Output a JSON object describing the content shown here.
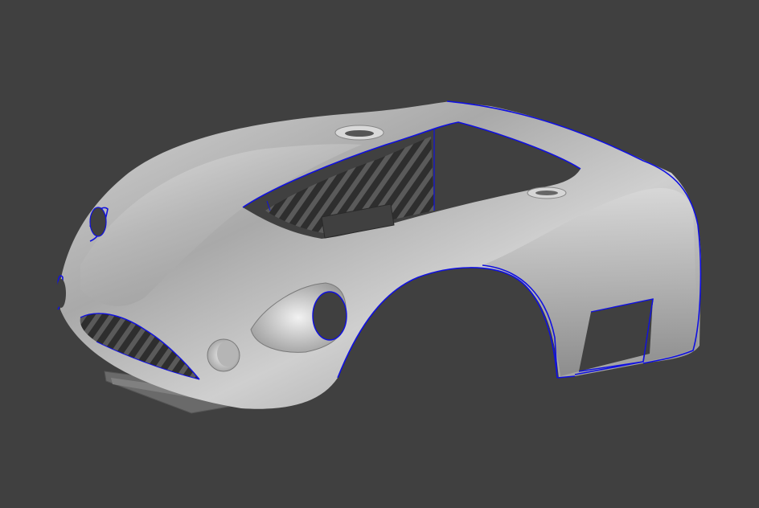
{
  "viewport": {
    "background_color": "#404040"
  },
  "model": {
    "body_color": "#bdbdbd",
    "edge_color": "#1010e0",
    "panel_color": "#2e2e2e",
    "panel_stripe_color": "#5a5a5a"
  }
}
